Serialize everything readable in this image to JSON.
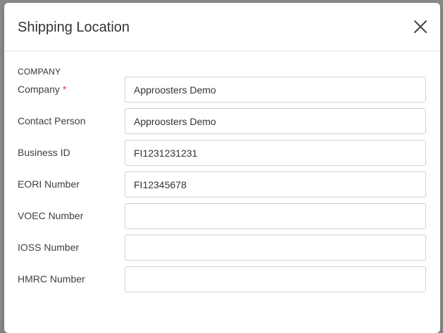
{
  "dialog": {
    "title": "Shipping Location",
    "close_icon": "close-icon"
  },
  "section": {
    "heading": "COMPANY"
  },
  "fields": [
    {
      "label": "Company",
      "required_mark": "*",
      "value": "Approosters Demo"
    },
    {
      "label": "Contact Person",
      "value": "Approosters Demo"
    },
    {
      "label": "Business ID",
      "value": "FI1231231231"
    },
    {
      "label": "EORI Number",
      "value": "FI12345678"
    },
    {
      "label": "VOEC Number",
      "value": ""
    },
    {
      "label": "IOSS Number",
      "value": ""
    },
    {
      "label": "HMRC Number",
      "value": ""
    }
  ],
  "colors": {
    "required": "#e53935",
    "border": "#cfcfcf",
    "backdrop": "#8c8c8c"
  }
}
